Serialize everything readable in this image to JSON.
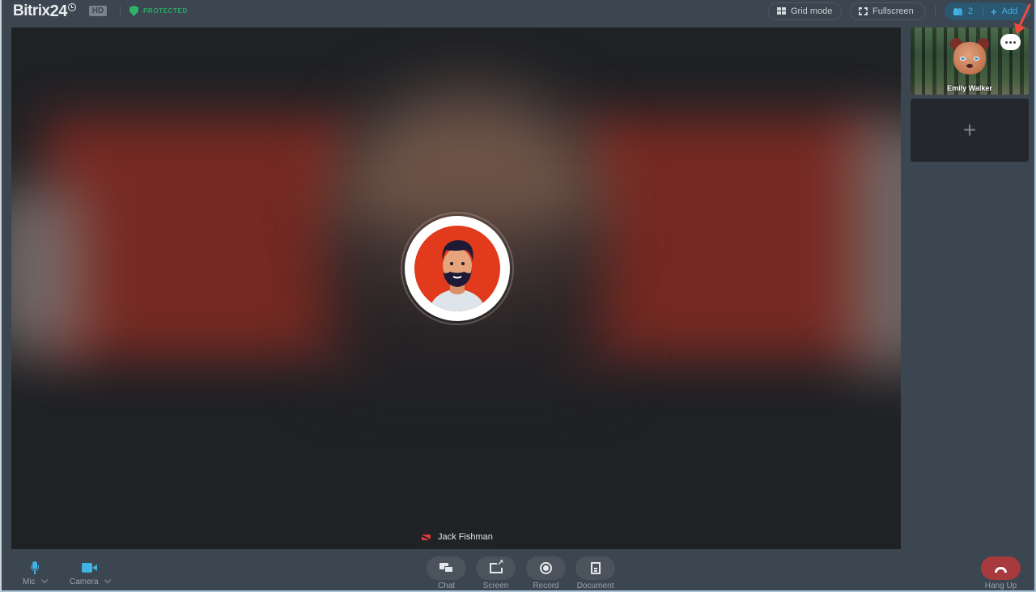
{
  "topbar": {
    "logo_text": "Bitrix",
    "logo_num": "24",
    "hd_label": "HD",
    "protected_label": "PROTECTED",
    "grid_mode_label": "Grid mode",
    "fullscreen_label": "Fullscreen",
    "participants_count": "2",
    "add_label": "Add"
  },
  "main_video": {
    "participant_name": "Jack Fishman",
    "camera_state": "off"
  },
  "sidebar": {
    "thumbnails": [
      {
        "name": "Emily Walker",
        "more_icon": "more-dots-icon"
      }
    ],
    "add_tile_symbol": "+"
  },
  "bottom_bar": {
    "mic_label": "Mic",
    "camera_label": "Camera",
    "chat_label": "Chat",
    "screen_label": "Screen",
    "record_label": "Record",
    "document_label": "Document",
    "hangup_label": "Hang Up"
  },
  "colors": {
    "background": "#3b4650",
    "accent": "#3fb3e6",
    "protected": "#2fa864",
    "hangup": "#a63a3d",
    "avatar_bg": "#e23a1c"
  }
}
